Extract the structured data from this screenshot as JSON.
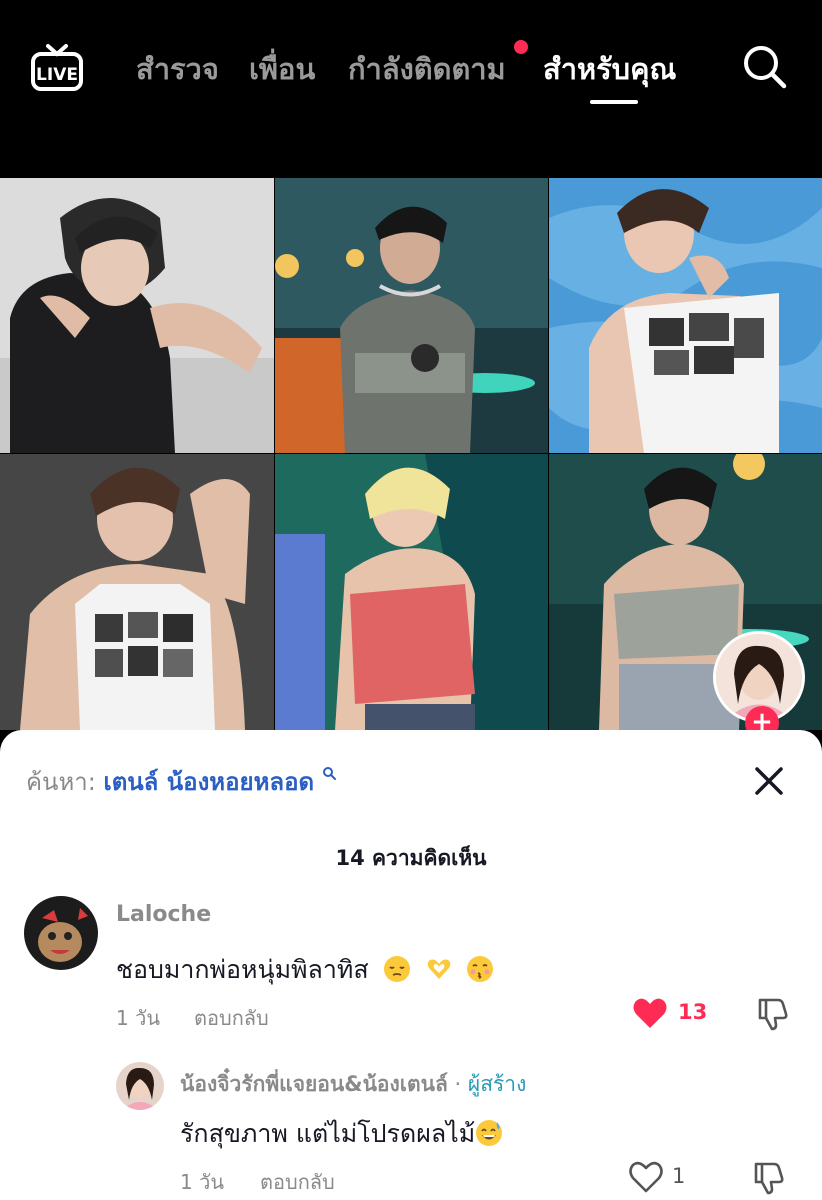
{
  "nav": {
    "live_label": "LIVE",
    "tabs": [
      {
        "label": "สำรวจ",
        "active": false
      },
      {
        "label": "เพื่อน",
        "active": false
      },
      {
        "label": "กำลังติดตาม",
        "active": false,
        "has_dot": true
      },
      {
        "label": "สำหรับคุณ",
        "active": true
      }
    ],
    "search_icon": "search-icon"
  },
  "grid": {
    "tiles": 6,
    "creator_follow_icon": "plus-icon"
  },
  "sheet": {
    "search_prefix": "ค้นหา:",
    "search_query": "เตนล์ น้องหอยหลอด",
    "close_icon": "close-icon",
    "comments_count": "14",
    "comments_label": "ความคิดเห็น",
    "comments": [
      {
        "username": "Laloche",
        "text": "ชอบมากพ่อหนุ่มพิลาทิส",
        "emojis": [
          "pensive-face",
          "heart-hands",
          "kissing-face-closed-eyes"
        ],
        "time": "1 วัน",
        "reply_label": "ตอบกลับ",
        "likes": "13",
        "liked": true
      },
      {
        "username": "น้องจิ๋วรักพี่แจยอน&น้องเตนล์",
        "separator": "·",
        "creator_tag": "ผู้สร้าง",
        "text": "รักสุขภาพ แต่ไม่โปรดผลไม้",
        "emojis": [
          "grinning-face-with-sweat"
        ],
        "time": "1 วัน",
        "reply_label": "ตอบกลับ",
        "likes": "1",
        "liked": false
      }
    ]
  },
  "colors": {
    "accent_red": "#fe2c55",
    "link_blue": "#2b5fc4",
    "creator_teal": "#2a9bb8"
  }
}
